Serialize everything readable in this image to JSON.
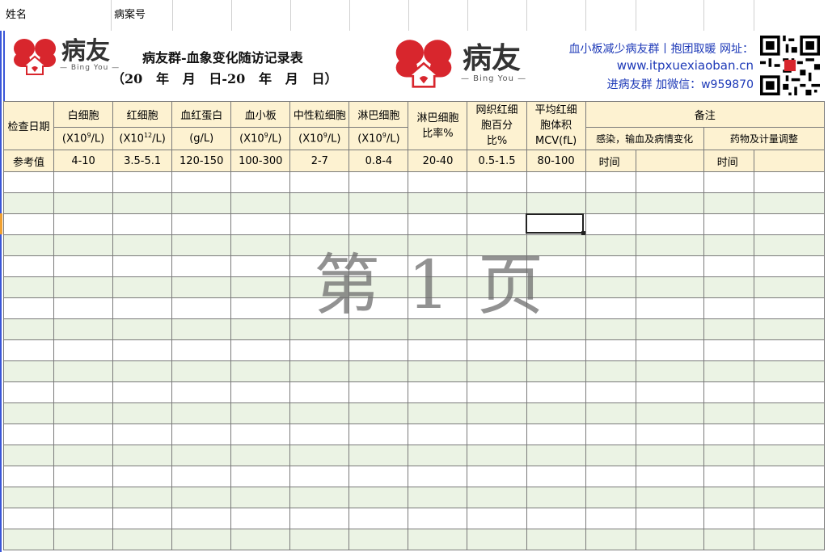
{
  "top_row": {
    "name_label": "姓名",
    "case_label": "病案号"
  },
  "logo": {
    "text": "病友",
    "sub": "— Bing You —"
  },
  "title": {
    "line1": "病友群-血象变化随访记录表",
    "line2": "（20   年   月   日-20   年   月   日）"
  },
  "info": {
    "line1": "血小板减少病友群丨抱团取暖 网址：",
    "line2": "www.itpxuexiaoban.cn",
    "line3": "进病友群 加微信：w959870"
  },
  "headers": {
    "date": "检查日期",
    "wbc": "白细胞",
    "wbc_unit_a": "(X10",
    "wbc_unit_sup": "9",
    "wbc_unit_b": "/L)",
    "rbc": "红细胞",
    "rbc_unit_a": "(X10",
    "rbc_unit_sup": "12",
    "rbc_unit_b": "/L)",
    "hgb": "血红蛋白",
    "hgb_unit": "(g/L)",
    "plt": "血小板",
    "plt_unit_a": "(X10",
    "plt_unit_sup": "9",
    "plt_unit_b": "/L)",
    "neut": "中性粒细胞",
    "neut_unit_a": "(X10",
    "neut_unit_sup": "9",
    "neut_unit_b": "/L)",
    "lymph": "淋巴细胞",
    "lymph_unit_a": "(X10",
    "lymph_unit_sup": "9",
    "lymph_unit_b": "/L)",
    "lymph_pct_1": "淋巴细胞",
    "lymph_pct_2": "比率%",
    "retic_1": "网织红细",
    "retic_2": "胞百分",
    "retic_3": "比%",
    "mcv_1": "平均红细",
    "mcv_2": "胞体积",
    "mcv_3": "MCV(fL)",
    "remarks": "备注",
    "remarks_a": "感染，输血及病情变化",
    "remarks_b": "药物及计量调整"
  },
  "reference": {
    "label": "参考值",
    "wbc": "4-10",
    "rbc": "3.5-5.1",
    "hgb": "120-150",
    "plt": "100-300",
    "neut": "2-7",
    "lymph": "0.8-4",
    "lymph_pct": "20-40",
    "retic": "0.5-1.5",
    "mcv": "80-100",
    "time_a": "时间",
    "time_b": "时间"
  },
  "watermark": "第 1 页",
  "colors": {
    "header_bg": "#fdf2d1",
    "alt_row_bg": "#ebf3e4",
    "brand_red": "#d8262d",
    "link_blue": "#1e3ab8"
  }
}
